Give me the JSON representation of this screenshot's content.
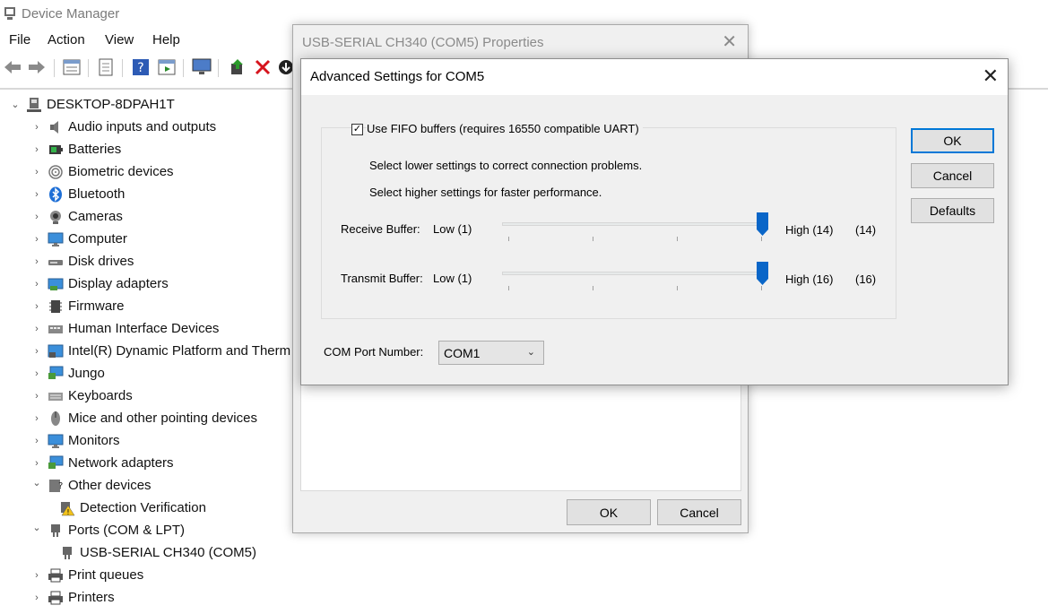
{
  "main_window": {
    "title": "Device Manager",
    "menu": [
      "File",
      "Action",
      "View",
      "Help"
    ]
  },
  "tree": {
    "root": "DESKTOP-8DPAH1T",
    "items": [
      {
        "label": "Audio inputs and outputs",
        "icon": "speaker-icon",
        "expanded": false
      },
      {
        "label": "Batteries",
        "icon": "battery-icon",
        "expanded": false
      },
      {
        "label": "Biometric devices",
        "icon": "fingerprint-icon",
        "expanded": false
      },
      {
        "label": "Bluetooth",
        "icon": "bluetooth-icon",
        "expanded": false
      },
      {
        "label": "Cameras",
        "icon": "camera-icon",
        "expanded": false
      },
      {
        "label": "Computer",
        "icon": "monitor-icon",
        "expanded": false
      },
      {
        "label": "Disk drives",
        "icon": "disk-drive-icon",
        "expanded": false
      },
      {
        "label": "Display adapters",
        "icon": "display-adapter-icon",
        "expanded": false
      },
      {
        "label": "Firmware",
        "icon": "chip-icon",
        "expanded": false
      },
      {
        "label": "Human Interface Devices",
        "icon": "hid-icon",
        "expanded": false
      },
      {
        "label": "Intel(R) Dynamic Platform and Therm",
        "icon": "intel-platform-icon",
        "expanded": false
      },
      {
        "label": "Jungo",
        "icon": "network-monitor-icon",
        "expanded": false
      },
      {
        "label": "Keyboards",
        "icon": "keyboard-icon",
        "expanded": false
      },
      {
        "label": "Mice and other pointing devices",
        "icon": "mouse-icon",
        "expanded": false
      },
      {
        "label": "Monitors",
        "icon": "monitor-icon",
        "expanded": false
      },
      {
        "label": "Network adapters",
        "icon": "network-monitor-icon",
        "expanded": false
      },
      {
        "label": "Other devices",
        "icon": "unknown-device-icon",
        "expanded": true
      },
      {
        "label": "Detection Verification",
        "icon": "warning-device-icon",
        "child": true
      },
      {
        "label": "Ports (COM & LPT)",
        "icon": "port-icon",
        "expanded": true
      },
      {
        "label": "USB-SERIAL CH340 (COM5)",
        "icon": "port-icon",
        "child": true
      },
      {
        "label": "Print queues",
        "icon": "printer-icon",
        "expanded": false
      },
      {
        "label": "Printers",
        "icon": "printer-icon",
        "expanded": false
      }
    ]
  },
  "properties_dialog": {
    "title": "USB-SERIAL CH340 (COM5) Properties",
    "ok_label": "OK",
    "cancel_label": "Cancel"
  },
  "advanced_dialog": {
    "title": "Advanced Settings for COM5",
    "fifo_label": "Use FIFO buffers (requires 16550 compatible UART)",
    "fifo_checked": true,
    "hint_lower": "Select lower settings to correct connection problems.",
    "hint_higher": "Select higher settings for faster performance.",
    "receive": {
      "label": "Receive Buffer:",
      "low": "Low (1)",
      "high": "High (14)",
      "value": "(14)",
      "level": 14,
      "max": 14
    },
    "transmit": {
      "label": "Transmit Buffer:",
      "low": "Low (1)",
      "high": "High (16)",
      "value": "(16)",
      "level": 16,
      "max": 16
    },
    "com_port_label": "COM Port Number:",
    "com_port_value": "COM1",
    "ok_label": "OK",
    "cancel_label": "Cancel",
    "defaults_label": "Defaults"
  }
}
